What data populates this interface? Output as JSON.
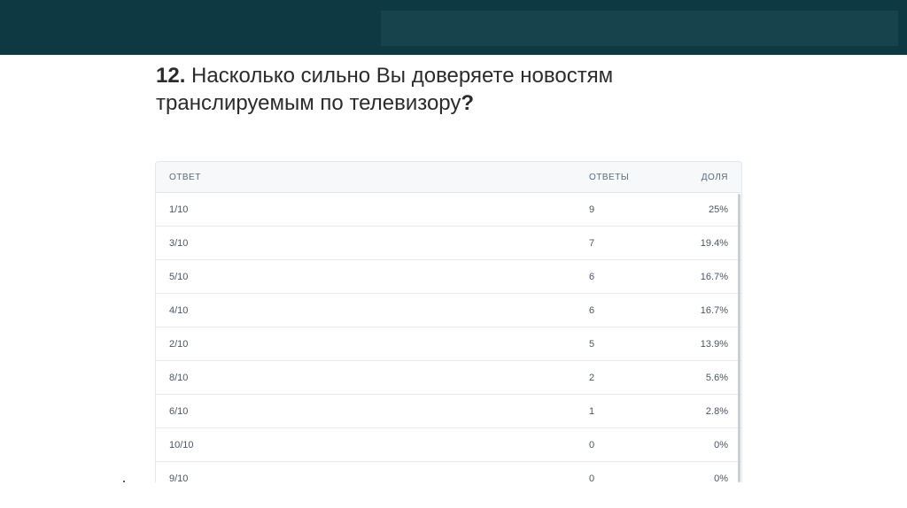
{
  "question": {
    "number": "12.",
    "text_line1": "Насколько сильно Вы доверяете новостям",
    "text_line2": "транслируемым по телевизору",
    "qmark": "?"
  },
  "table": {
    "headers": {
      "answer": "ОТВЕТ",
      "count": "ОТВЕТЫ",
      "share": "ДОЛЯ"
    },
    "rows": [
      {
        "answer": "1/10",
        "count": "9",
        "share": "25%"
      },
      {
        "answer": "3/10",
        "count": "7",
        "share": "19.4%"
      },
      {
        "answer": "5/10",
        "count": "6",
        "share": "16.7%"
      },
      {
        "answer": "4/10",
        "count": "6",
        "share": "16.7%"
      },
      {
        "answer": "2/10",
        "count": "5",
        "share": "13.9%"
      },
      {
        "answer": "8/10",
        "count": "2",
        "share": "5.6%"
      },
      {
        "answer": "6/10",
        "count": "1",
        "share": "2.8%"
      },
      {
        "answer": "10/10",
        "count": "0",
        "share": "0%"
      },
      {
        "answer": "9/10",
        "count": "0",
        "share": "0%"
      }
    ]
  },
  "colors": {
    "header_bar": "#0f3942",
    "text": "#2b2b2b"
  }
}
